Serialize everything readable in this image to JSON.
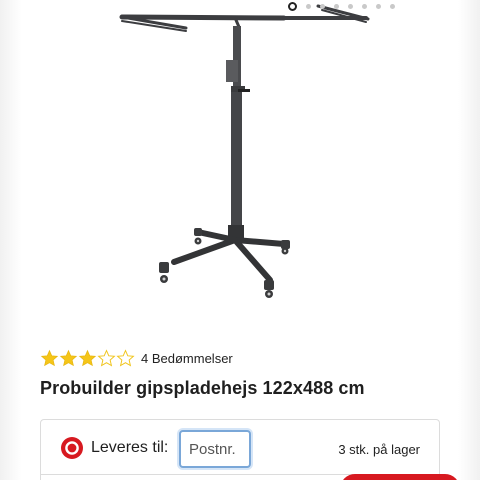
{
  "carousel": {
    "slide_count": 8,
    "active_index": 0
  },
  "product": {
    "rating": 3,
    "rating_max": 5,
    "rating_text": "4 Bedømmelser",
    "title": "Probuilder gipspladehejs 122x488 cm"
  },
  "delivery": {
    "label": "Leveres til:",
    "postnr_placeholder": "Postnr.",
    "stock_text": "3 stk. på lager"
  },
  "colors": {
    "star_filled": "#f5c518",
    "star_outline": "#f0c419",
    "accent_red": "#d71920",
    "input_focus": "#7aa7d8"
  },
  "icons": {
    "location": "location-target-icon",
    "star": "star-icon"
  }
}
